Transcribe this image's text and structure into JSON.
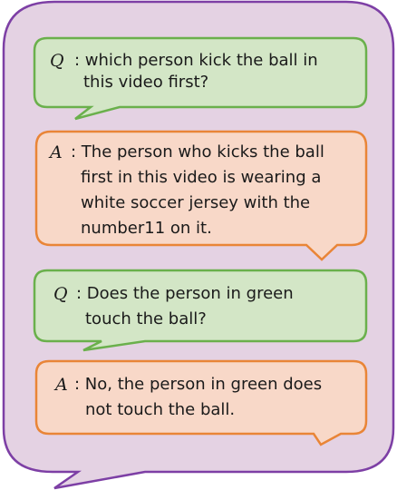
{
  "colors": {
    "outer_fill": "#e4d2e3",
    "outer_stroke": "#7d3fa5",
    "question_fill": "#d3e6c6",
    "question_stroke": "#6ab04c",
    "answer_fill": "#f8d8c8",
    "answer_stroke": "#e98537"
  },
  "dialogue": [
    {
      "speaker": "Q",
      "text_line1": ": which person kick the ball in",
      "text_line2": "this video first?",
      "text_line3": "",
      "text_line4": ""
    },
    {
      "speaker": "A",
      "text_line1": ": The person who kicks the ball",
      "text_line2": "first in this video is wearing a",
      "text_line3": "white soccer jersey with the",
      "text_line4": "number11 on it."
    },
    {
      "speaker": "Q",
      "text_line1": ": Does the person in green",
      "text_line2": "touch the ball?",
      "text_line3": "",
      "text_line4": ""
    },
    {
      "speaker": "A",
      "text_line1": ": No, the person in green does",
      "text_line2": "not touch the ball.",
      "text_line3": "",
      "text_line4": ""
    }
  ]
}
